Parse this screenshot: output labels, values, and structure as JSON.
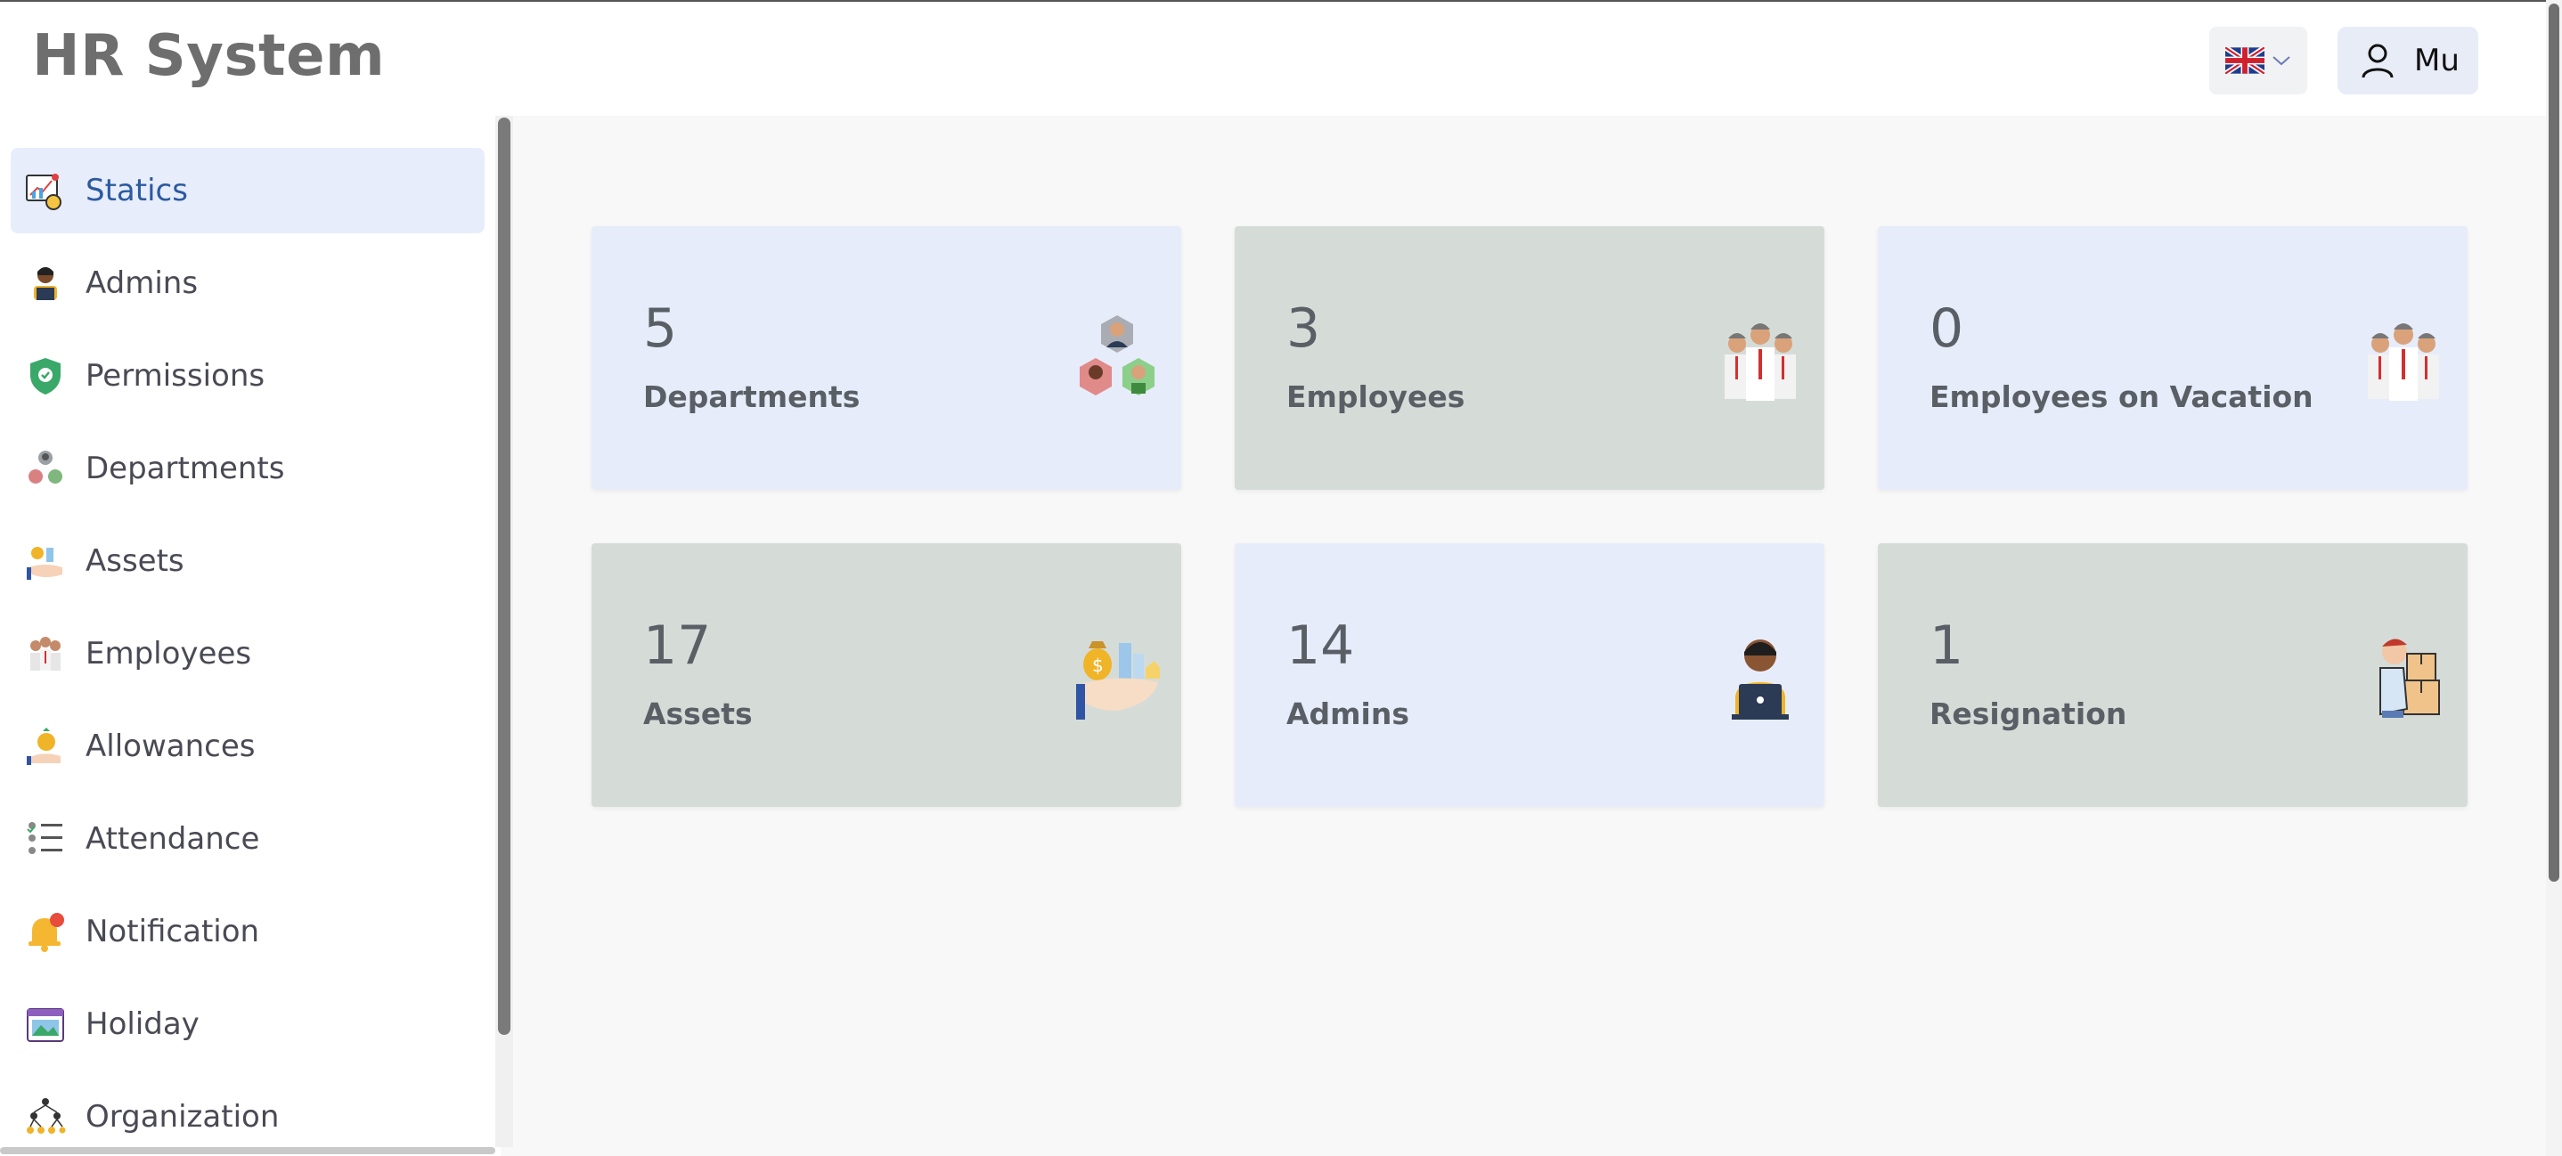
{
  "app": {
    "title": "HR System"
  },
  "header": {
    "language_icon": "uk-flag-icon",
    "user_name": "Mu"
  },
  "sidebar": {
    "items": [
      {
        "label": "Statics",
        "icon": "statistics-icon",
        "active": true
      },
      {
        "label": "Admins",
        "icon": "admin-icon"
      },
      {
        "label": "Permissions",
        "icon": "shield-icon"
      },
      {
        "label": "Departments",
        "icon": "departments-icon"
      },
      {
        "label": "Assets",
        "icon": "assets-icon"
      },
      {
        "label": "Employees",
        "icon": "employees-icon"
      },
      {
        "label": "Allowances",
        "icon": "allowances-icon"
      },
      {
        "label": "Attendance",
        "icon": "attendance-icon"
      },
      {
        "label": "Notification",
        "icon": "bell-icon"
      },
      {
        "label": "Holiday",
        "icon": "calendar-icon"
      },
      {
        "label": "Organization",
        "icon": "organization-icon"
      }
    ]
  },
  "cards": [
    {
      "value": "5",
      "label": "Departments",
      "icon": "departments-icon",
      "color": "#e7ecfa"
    },
    {
      "value": "3",
      "label": "Employees",
      "icon": "employees-icon",
      "color": "#d5dcd8"
    },
    {
      "value": "0",
      "label": "Employees on Vacation",
      "icon": "employees-icon",
      "color": "#e7ecfa"
    },
    {
      "value": "17",
      "label": "Assets",
      "icon": "assets-icon",
      "color": "#d5dcd8"
    },
    {
      "value": "14",
      "label": "Admins",
      "icon": "admin-icon",
      "color": "#e7ecfa"
    },
    {
      "value": "1",
      "label": "Resignation",
      "icon": "resignation-icon",
      "color": "#d5dcd8"
    }
  ],
  "colors": {
    "accent": "#2b5aa1",
    "active_bg": "#e8edfb",
    "card_blue": "#e7ecfa",
    "card_gray": "#d5dcd8"
  }
}
